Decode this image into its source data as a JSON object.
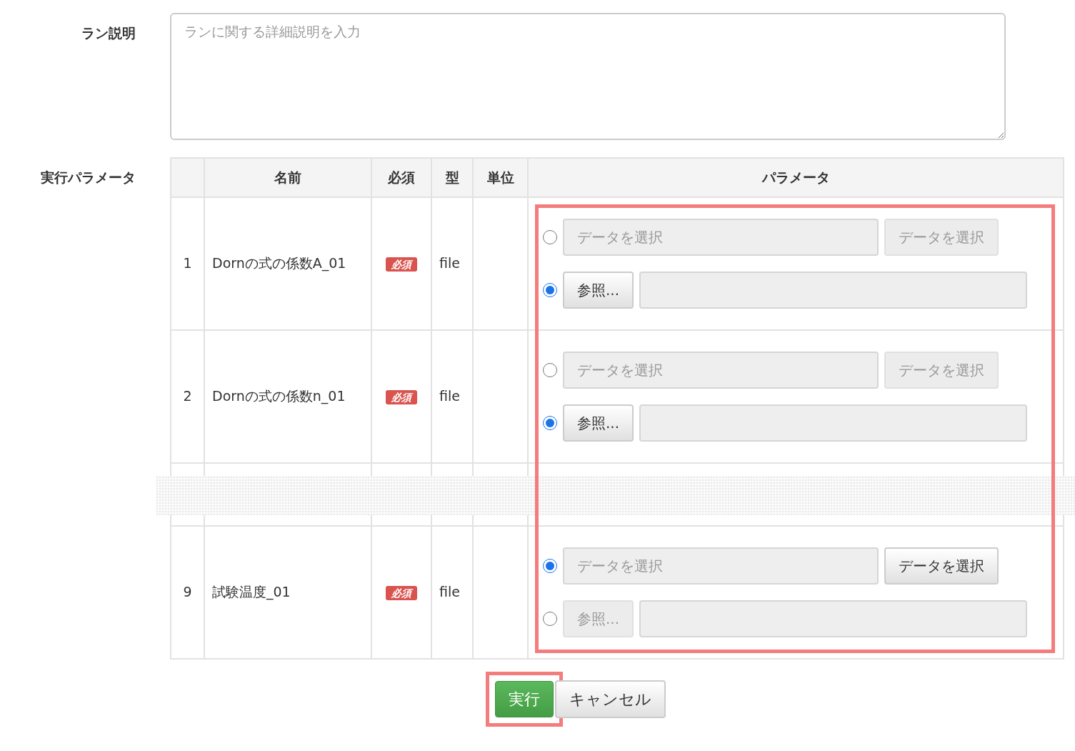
{
  "description": {
    "label": "ラン説明",
    "placeholder": "ランに関する詳細説明を入力"
  },
  "parameters": {
    "label": "実行パラメータ",
    "columns": [
      "",
      "名前",
      "必須",
      "型",
      "単位",
      "パラメータ"
    ],
    "highlighted": true,
    "rows": [
      {
        "kind": "row",
        "number": "1",
        "name": "Dornの式の係数A_01",
        "required": "必須",
        "type": "file",
        "options": [
          {
            "kind": "data",
            "selected": false,
            "placeholder": "データを選択",
            "button": "データを選択"
          },
          {
            "kind": "file",
            "selected": true,
            "button": "参照..."
          }
        ]
      },
      {
        "kind": "row",
        "number": "2",
        "name": "Dornの式の係数n_01",
        "required": "必須",
        "type": "file",
        "options": [
          {
            "kind": "data",
            "selected": false,
            "placeholder": "データを選択",
            "button": "データを選択"
          },
          {
            "kind": "file",
            "selected": true,
            "button": "参照..."
          }
        ]
      },
      {
        "kind": "gap"
      },
      {
        "kind": "row",
        "number": "9",
        "name": "試験温度_01",
        "required": "必須",
        "type": "file",
        "options": [
          {
            "kind": "data",
            "selected": true,
            "placeholder": "データを選択",
            "button": "データを選択"
          },
          {
            "kind": "file",
            "selected": false,
            "button": "参照..."
          }
        ]
      }
    ]
  },
  "buttons": [
    {
      "kind": "primary",
      "label": "実行",
      "highlighted": true
    },
    {
      "kind": "default",
      "label": "キャンセル",
      "highlighted": false
    }
  ]
}
